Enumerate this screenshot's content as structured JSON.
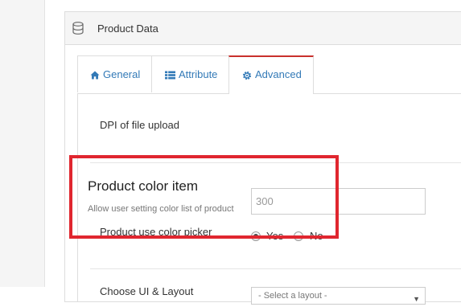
{
  "panel": {
    "title": "Product Data",
    "icon": "database-icon"
  },
  "tabs": [
    {
      "label": "General",
      "icon": "home-icon",
      "active": false
    },
    {
      "label": "Attribute",
      "icon": "th-list-icon",
      "active": false
    },
    {
      "label": "Advanced",
      "icon": "gear-icon",
      "active": true
    }
  ],
  "dpi": {
    "label": "DPI of file upload",
    "value": "300"
  },
  "color_section": {
    "title": "Product color item",
    "description": "Allow user setting color list of product",
    "picker_label": "Product use color picker",
    "options": [
      {
        "label": "Yes",
        "checked": true
      },
      {
        "label": "No",
        "checked": false
      }
    ]
  },
  "layout": {
    "label": "Choose UI & Layout",
    "select_value": "- Select a layout -"
  },
  "colors": {
    "accent": "#337ab7",
    "active_tab_border": "#c9302c",
    "highlight": "#e0262f"
  }
}
